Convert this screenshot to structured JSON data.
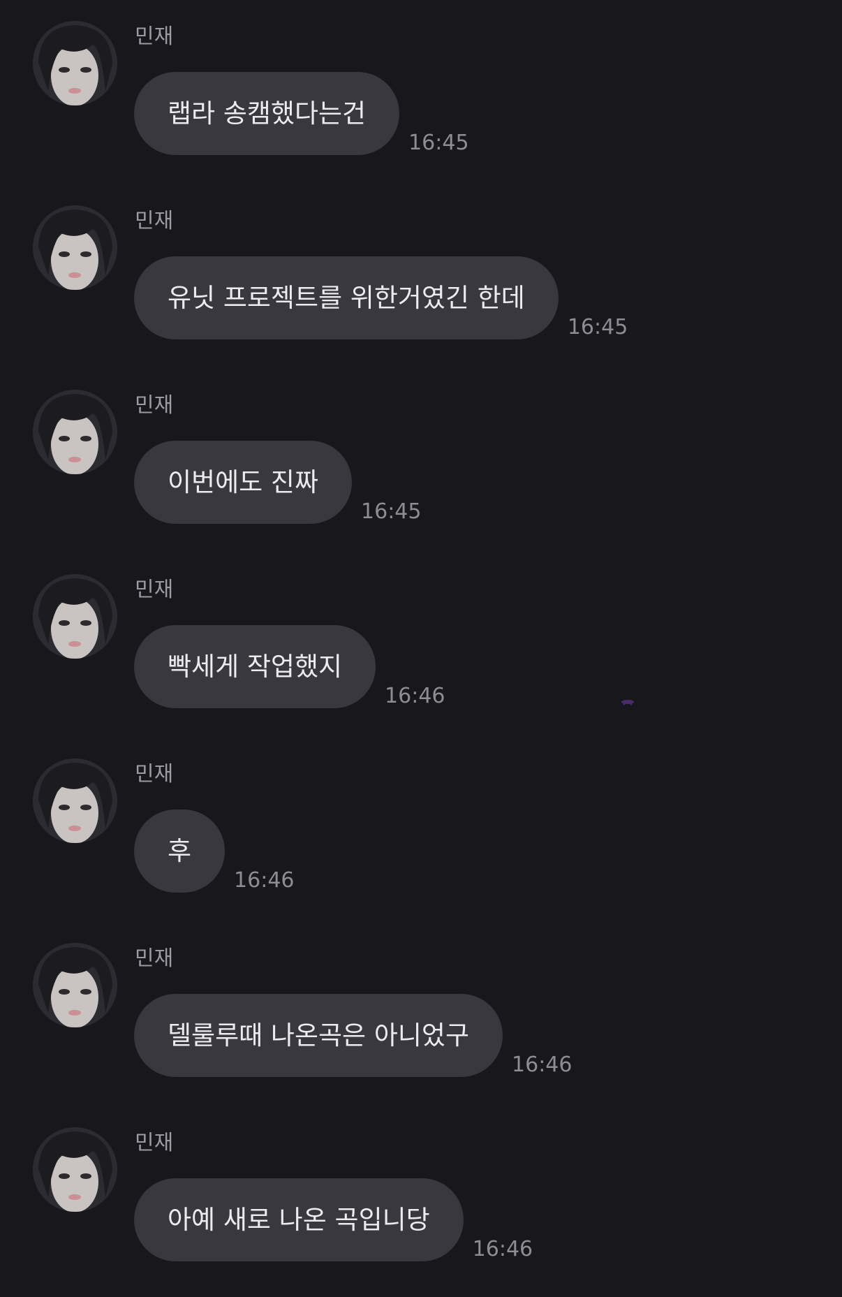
{
  "messages": [
    {
      "sender": "민재",
      "text": "랩라 송캠했다는건",
      "time": "16:45"
    },
    {
      "sender": "민재",
      "text": "유닛 프로젝트를 위한거였긴 한데",
      "time": "16:45"
    },
    {
      "sender": "민재",
      "text": "이번에도 진짜",
      "time": "16:45"
    },
    {
      "sender": "민재",
      "text": "빡세게 작업했지",
      "time": "16:46"
    },
    {
      "sender": "민재",
      "text": "후",
      "time": "16:46"
    },
    {
      "sender": "민재",
      "text": "델룰루때 나온곡은 아니었구",
      "time": "16:46"
    },
    {
      "sender": "민재",
      "text": "아예 새로 나온 곡입니당",
      "time": "16:46"
    }
  ],
  "colors": {
    "background": "#17171c",
    "bubble": "#38383e",
    "text": "#ececef",
    "sender": "#9b9ba3",
    "timestamp": "#8d8d94"
  },
  "avatar_icon": "profile-photo"
}
